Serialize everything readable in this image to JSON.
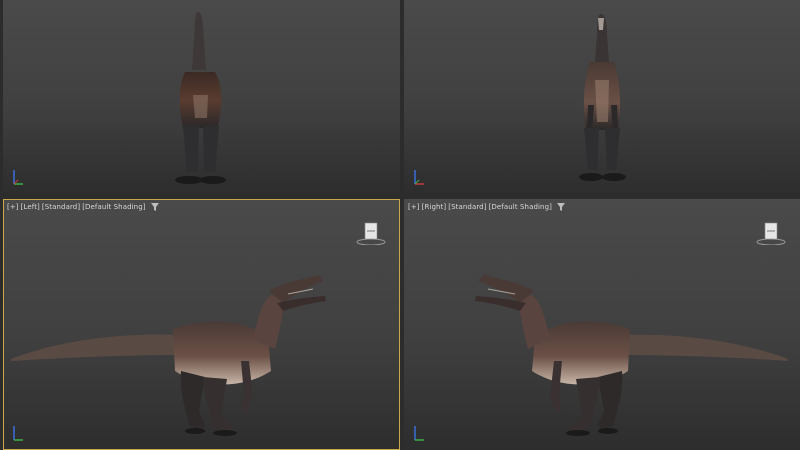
{
  "viewports": {
    "top_left": {
      "active": false
    },
    "top_right": {
      "active": false
    },
    "bottom_left": {
      "active": true,
      "label": {
        "plus": "[+]",
        "view": "[Left]",
        "style": "[Standard]",
        "shading": "[Default Shading]"
      },
      "viewcube_face": "LEFT"
    },
    "bottom_right": {
      "active": false,
      "label": {
        "plus": "[+]",
        "view": "[Right]",
        "style": "[Standard]",
        "shading": "[Default Shading]"
      },
      "viewcube_face": "RIGHT"
    }
  },
  "colors": {
    "active_border": "#c9a84b",
    "viewport_top": "#4a4a4a",
    "viewport_bottom": "#2d2d2d",
    "label_text": "#d8d8d8",
    "model_body": "#5a4a44",
    "model_dark": "#1e1c1c"
  },
  "icons": [
    "filter-icon",
    "viewcube-icon",
    "axis-gizmo-icon"
  ]
}
